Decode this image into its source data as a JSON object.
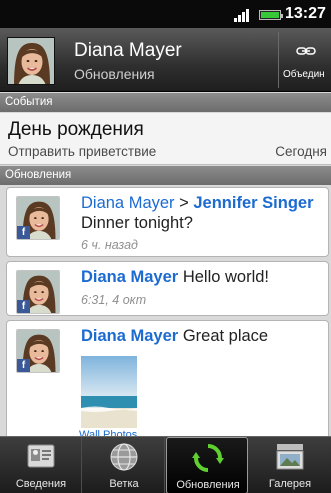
{
  "status_bar": {
    "time": "13:27",
    "signal_icon": "signal-bars-icon",
    "battery_icon": "battery-icon",
    "battery_color": "#37c83a"
  },
  "contact": {
    "name": "Diana Mayer",
    "subtitle": "Обновления",
    "link_button_label": "Объедин",
    "link_icon": "chain-link-icon"
  },
  "events_section": {
    "header": "События",
    "item": {
      "title": "День рождения",
      "action": "Отправить приветствие",
      "date": "Сегодня"
    }
  },
  "updates_section": {
    "header": "Обновления",
    "items": [
      {
        "author": "Diana Mayer",
        "arrow": ">",
        "recipient": "Jennifer Singer",
        "message": "Dinner tonight?",
        "time": "6 ч. назад",
        "badge": "f"
      },
      {
        "author": "Diana Mayer",
        "message": "Hello world!",
        "time": "6:31, 4 окт",
        "badge": "f"
      },
      {
        "author": "Diana Mayer",
        "message": "Great place",
        "photo_album": "Wall Photos",
        "badge": "f"
      }
    ]
  },
  "tabs": [
    {
      "label": "Сведения",
      "icon": "contact-card-icon",
      "active": false
    },
    {
      "label": "Ветка",
      "icon": "globe-icon",
      "active": false
    },
    {
      "label": "Обновления",
      "icon": "refresh-icon",
      "active": true
    },
    {
      "label": "Галерея",
      "icon": "photo-gallery-icon",
      "active": false
    }
  ],
  "colors": {
    "link_blue": "#1c6bd1",
    "facebook_blue": "#3b5998",
    "refresh_green": "#5fd030"
  }
}
